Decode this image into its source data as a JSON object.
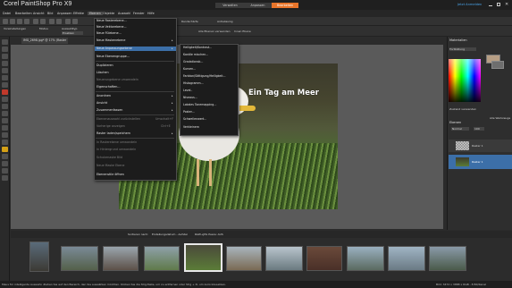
{
  "app_title": "Corel PaintShop Pro X9",
  "workspace_tabs": [
    "Verwalten",
    "Anpassen",
    "Bearbeiten"
  ],
  "login": "Jetzt Anmelden",
  "menubar": [
    "Datei",
    "Bearbeiten",
    "Ansicht",
    "Bild",
    "Anpassen",
    "Effekte",
    "Ebenen",
    "Objekte",
    "Auswahl",
    "Fenster",
    "Hilfe"
  ],
  "toolbar2": {
    "preset_label": "Voreinstellungen",
    "mode_label": "Modus",
    "mode_value": "Ersetzen",
    "selection_label": "Auswahltyp",
    "feather_label": "Randschärfe",
    "antialias_label": "Antialiasing",
    "aura_label": "Alle Ebenen verwenden",
    "outside_label": "Innen Ebene"
  },
  "document_tab": "IMG_2698.jpg* @ 17% (Raster 1)",
  "photo_text": "Ein Tag am Meer",
  "effects_menu": {
    "items": [
      {
        "label": "Neue Rasterebene...",
        "dim": false
      },
      {
        "label": "Neue Vektorebene...",
        "dim": false
      },
      {
        "label": "Neue Fülebene...",
        "dim": false
      },
      {
        "label": "Neue Maskenebene",
        "dim": false
      },
      {
        "label": "Neue Anpassungsebene",
        "dim": false
      },
      {
        "label": "Neue Ebenengruppe...",
        "dim": false
      },
      {
        "label": "Duplizieren",
        "dim": false
      },
      {
        "label": "Löschen",
        "dim": false
      },
      {
        "label": "Neuerungebene umwandeln",
        "dim": true
      },
      {
        "label": "Eigenschaften...",
        "dim": false
      },
      {
        "label": "Anordnen",
        "dim": false
      },
      {
        "label": "Ansicht",
        "dim": false
      },
      {
        "label": "Zusammenfassen",
        "dim": false
      },
      {
        "label": "Ebenenauswahl zurückstellen",
        "dim": true
      },
      {
        "label": "Vorherige anzeigen",
        "dim": true
      },
      {
        "label": "Raster laden/speichern",
        "dim": false
      },
      {
        "label": "In Rasterebene umwandeln",
        "dim": true
      },
      {
        "label": "In Hintergrund umwandeln",
        "dim": true
      },
      {
        "label": "Schutzmaske Bild",
        "dim": true
      },
      {
        "label": "Neue Maske Ebene",
        "dim": true
      },
      {
        "label": "Ebenenstile öffnen",
        "dim": false
      }
    ],
    "highlighted_index": 4,
    "shortcuts": {
      "13": "Umschalt+F",
      "14": "Ctrl+E"
    }
  },
  "submenu": {
    "items": [
      "Helligkeit/Kontrast...",
      "Kanäle mischen...",
      "Gradationsk...",
      "Kurven...",
      "Farbton/Sättigung/Helligkeit...",
      "Histogramm...",
      "Level..",
      "Niveaus...",
      "Lokales Tonemapping...",
      "Poster...",
      "Schwellenwert...",
      "Verkleinern"
    ]
  },
  "right_panel": {
    "materials_title": "Materialien",
    "palette_label": "Fortbildung",
    "transparency_label": "Zustand verwenden",
    "layers_title": "Ebenen",
    "layer_mode": "Normal",
    "opacity_value": "100",
    "layers": [
      "Raster 1",
      "Raster 1"
    ],
    "all_tools": "Alle Werkzeuge"
  },
  "organizer": {
    "sort_label": "Sortieren nach:",
    "sort_value": "Erstellungsdatum - Aufstei",
    "filter_value": "RAW+JPG Paare: AUS",
    "thumb_count": 11
  },
  "status_left": "Maus für intelligente Auswahl. Ziehen Sie auf den Bereich, den Sie auswählen möchten. Klicken Sie die Strg-Taste, um zu entfernen oder Strg + D, um zurückzusetzen.",
  "status_right": "Bild: 3472 x 3888 x RGB - 8 Bit/Kanal"
}
